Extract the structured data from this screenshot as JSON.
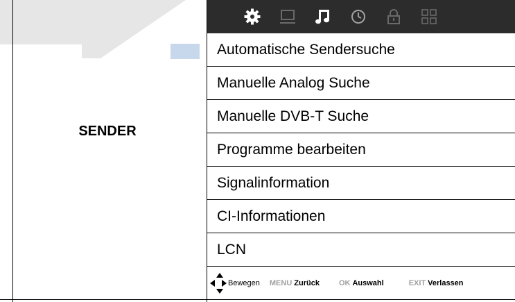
{
  "category": {
    "label": "SENDER"
  },
  "icon_bar": {
    "icons": [
      "gear-icon",
      "monitor-icon",
      "music-note-icon",
      "clock-icon",
      "lock-icon",
      "grid-icon"
    ],
    "active_icon": "gear-icon",
    "bar_color": "#2c2c2c",
    "active_color": "#ffffff",
    "inactive_color": "#6a6a6a"
  },
  "menu": {
    "items": [
      {
        "label": "Automatische Sendersuche"
      },
      {
        "label": "Manuelle Analog Suche"
      },
      {
        "label": "Manuelle DVB-T Suche"
      },
      {
        "label": "Programme bearbeiten"
      },
      {
        "label": "Signalinformation"
      },
      {
        "label": "CI-Informationen"
      },
      {
        "label": "LCN"
      }
    ]
  },
  "footer": {
    "move_label": "Bewegen",
    "menu_key": "MENU",
    "back_label": "Zurück",
    "ok_key": "OK",
    "select_label": "Auswahl",
    "exit_key": "EXIT",
    "leave_label": "Verlassen"
  }
}
